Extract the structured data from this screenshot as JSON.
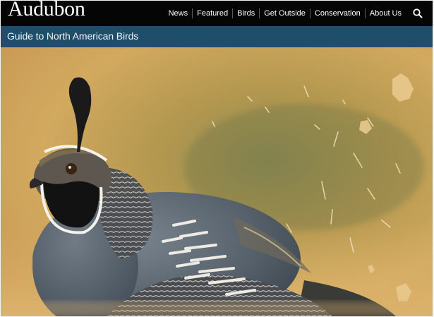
{
  "site": {
    "logo_text": "Audubon"
  },
  "nav": {
    "items": [
      {
        "label": "News"
      },
      {
        "label": "Featured"
      },
      {
        "label": "Birds"
      },
      {
        "label": "Get Outside"
      },
      {
        "label": "Conservation"
      },
      {
        "label": "About Us"
      }
    ],
    "search_icon": "search-icon"
  },
  "subheader": {
    "title": "Guide to North American Birds"
  },
  "hero": {
    "image": "california-quail-photo"
  },
  "colors": {
    "topbar": "#050505",
    "subbar": "#1f4e6b",
    "hero_background": "#c9a25a",
    "bird_body": "#5b6670"
  }
}
